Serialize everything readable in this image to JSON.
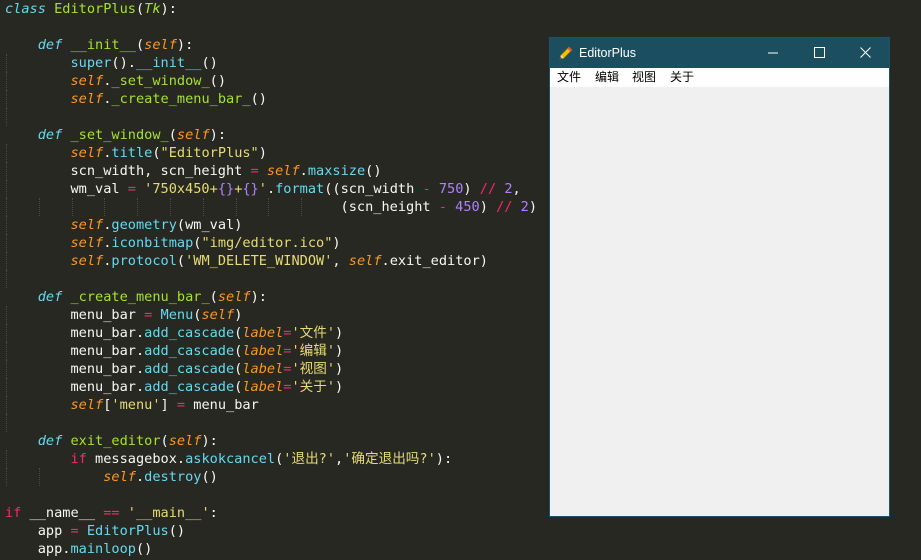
{
  "code": {
    "lines": [
      [
        [
          "kwi",
          "class"
        ],
        [
          "plain",
          " "
        ],
        [
          "cls",
          "EditorPlus"
        ],
        [
          "plain",
          "("
        ],
        [
          "inh",
          "Tk"
        ],
        [
          "plain",
          "):"
        ]
      ],
      [],
      [
        [
          "plain",
          "    "
        ],
        [
          "kwi",
          "def"
        ],
        [
          "plain",
          " "
        ],
        [
          "fn",
          "__init__"
        ],
        [
          "plain",
          "("
        ],
        [
          "self",
          "self"
        ],
        [
          "plain",
          "):"
        ]
      ],
      [
        [
          "plain",
          "        "
        ],
        [
          "builtin",
          "super"
        ],
        [
          "plain",
          "()."
        ],
        [
          "builtin",
          "__init__"
        ],
        [
          "plain",
          "()"
        ]
      ],
      [
        [
          "plain",
          "        "
        ],
        [
          "self",
          "self"
        ],
        [
          "plain",
          "."
        ],
        [
          "fn",
          "_set_window_"
        ],
        [
          "plain",
          "()"
        ]
      ],
      [
        [
          "plain",
          "        "
        ],
        [
          "self",
          "self"
        ],
        [
          "plain",
          "."
        ],
        [
          "fn",
          "_create_menu_bar_"
        ],
        [
          "plain",
          "()"
        ]
      ],
      [],
      [
        [
          "plain",
          "    "
        ],
        [
          "kwi",
          "def"
        ],
        [
          "plain",
          " "
        ],
        [
          "fn",
          "_set_window_"
        ],
        [
          "plain",
          "("
        ],
        [
          "self",
          "self"
        ],
        [
          "plain",
          "):"
        ]
      ],
      [
        [
          "plain",
          "        "
        ],
        [
          "self",
          "self"
        ],
        [
          "plain",
          "."
        ],
        [
          "builtin",
          "title"
        ],
        [
          "plain",
          "("
        ],
        [
          "str",
          "\"EditorPlus\""
        ],
        [
          "plain",
          ")"
        ]
      ],
      [
        [
          "plain",
          "        scn_width, scn_height "
        ],
        [
          "op",
          "="
        ],
        [
          "plain",
          " "
        ],
        [
          "self",
          "self"
        ],
        [
          "plain",
          "."
        ],
        [
          "builtin",
          "maxsize"
        ],
        [
          "plain",
          "()"
        ]
      ],
      [
        [
          "plain",
          "        wm_val "
        ],
        [
          "op",
          "="
        ],
        [
          "plain",
          " "
        ],
        [
          "str",
          "'750x450+"
        ],
        [
          "num",
          "{}"
        ],
        [
          "str",
          "+"
        ],
        [
          "num",
          "{}"
        ],
        [
          "str",
          "'"
        ],
        [
          "plain",
          "."
        ],
        [
          "builtin",
          "format"
        ],
        [
          "plain",
          "((scn_width "
        ],
        [
          "op",
          "-"
        ],
        [
          "plain",
          " "
        ],
        [
          "num",
          "750"
        ],
        [
          "plain",
          ") "
        ],
        [
          "op",
          "//"
        ],
        [
          "plain",
          " "
        ],
        [
          "num",
          "2"
        ],
        [
          "plain",
          ","
        ]
      ],
      [
        [
          "plain",
          "                                         (scn_height "
        ],
        [
          "op",
          "-"
        ],
        [
          "plain",
          " "
        ],
        [
          "num",
          "450"
        ],
        [
          "plain",
          ") "
        ],
        [
          "op",
          "//"
        ],
        [
          "plain",
          " "
        ],
        [
          "num",
          "2"
        ],
        [
          "plain",
          ")"
        ]
      ],
      [
        [
          "plain",
          "        "
        ],
        [
          "self",
          "self"
        ],
        [
          "plain",
          "."
        ],
        [
          "builtin",
          "geometry"
        ],
        [
          "plain",
          "(wm_val)"
        ]
      ],
      [
        [
          "plain",
          "        "
        ],
        [
          "self",
          "self"
        ],
        [
          "plain",
          "."
        ],
        [
          "builtin",
          "iconbitmap"
        ],
        [
          "plain",
          "("
        ],
        [
          "str",
          "\"img/editor.ico\""
        ],
        [
          "plain",
          ")"
        ]
      ],
      [
        [
          "plain",
          "        "
        ],
        [
          "self",
          "self"
        ],
        [
          "plain",
          "."
        ],
        [
          "builtin",
          "protocol"
        ],
        [
          "plain",
          "("
        ],
        [
          "str",
          "'WM_DELETE_WINDOW'"
        ],
        [
          "plain",
          ", "
        ],
        [
          "self",
          "self"
        ],
        [
          "plain",
          ".exit_editor)"
        ]
      ],
      [],
      [
        [
          "plain",
          "    "
        ],
        [
          "kwi",
          "def"
        ],
        [
          "plain",
          " "
        ],
        [
          "fn",
          "_create_menu_bar_"
        ],
        [
          "plain",
          "("
        ],
        [
          "self",
          "self"
        ],
        [
          "plain",
          "):"
        ]
      ],
      [
        [
          "plain",
          "        menu_bar "
        ],
        [
          "op",
          "="
        ],
        [
          "plain",
          " "
        ],
        [
          "builtin",
          "Menu"
        ],
        [
          "plain",
          "("
        ],
        [
          "self",
          "self"
        ],
        [
          "plain",
          ")"
        ]
      ],
      [
        [
          "plain",
          "        menu_bar."
        ],
        [
          "builtin",
          "add_cascade"
        ],
        [
          "plain",
          "("
        ],
        [
          "param",
          "label"
        ],
        [
          "op",
          "="
        ],
        [
          "str",
          "'文件'"
        ],
        [
          "plain",
          ")"
        ]
      ],
      [
        [
          "plain",
          "        menu_bar."
        ],
        [
          "builtin",
          "add_cascade"
        ],
        [
          "plain",
          "("
        ],
        [
          "param",
          "label"
        ],
        [
          "op",
          "="
        ],
        [
          "str",
          "'编辑'"
        ],
        [
          "plain",
          ")"
        ]
      ],
      [
        [
          "plain",
          "        menu_bar."
        ],
        [
          "builtin",
          "add_cascade"
        ],
        [
          "plain",
          "("
        ],
        [
          "param",
          "label"
        ],
        [
          "op",
          "="
        ],
        [
          "str",
          "'视图'"
        ],
        [
          "plain",
          ")"
        ]
      ],
      [
        [
          "plain",
          "        menu_bar."
        ],
        [
          "builtin",
          "add_cascade"
        ],
        [
          "plain",
          "("
        ],
        [
          "param",
          "label"
        ],
        [
          "op",
          "="
        ],
        [
          "str",
          "'关于'"
        ],
        [
          "plain",
          ")"
        ]
      ],
      [
        [
          "plain",
          "        "
        ],
        [
          "self",
          "self"
        ],
        [
          "plain",
          "["
        ],
        [
          "str",
          "'menu'"
        ],
        [
          "plain",
          "] "
        ],
        [
          "op",
          "="
        ],
        [
          "plain",
          " menu_bar"
        ]
      ],
      [],
      [
        [
          "plain",
          "    "
        ],
        [
          "kwi",
          "def"
        ],
        [
          "plain",
          " "
        ],
        [
          "fn",
          "exit_editor"
        ],
        [
          "plain",
          "("
        ],
        [
          "self",
          "self"
        ],
        [
          "plain",
          "):"
        ]
      ],
      [
        [
          "plain",
          "        "
        ],
        [
          "kw",
          "if"
        ],
        [
          "plain",
          " messagebox."
        ],
        [
          "builtin",
          "askokcancel"
        ],
        [
          "plain",
          "("
        ],
        [
          "str",
          "'退出?'"
        ],
        [
          "plain",
          ","
        ],
        [
          "str",
          "'确定退出吗?'"
        ],
        [
          "plain",
          "):"
        ]
      ],
      [
        [
          "plain",
          "            "
        ],
        [
          "self",
          "self"
        ],
        [
          "plain",
          "."
        ],
        [
          "builtin",
          "destroy"
        ],
        [
          "plain",
          "()"
        ]
      ],
      [],
      [
        [
          "kw",
          "if"
        ],
        [
          "plain",
          " __name__ "
        ],
        [
          "op",
          "=="
        ],
        [
          "plain",
          " "
        ],
        [
          "str",
          "'__main__'"
        ],
        [
          "plain",
          ":"
        ]
      ],
      [
        [
          "plain",
          "    app "
        ],
        [
          "op",
          "="
        ],
        [
          "plain",
          " "
        ],
        [
          "builtin",
          "EditorPlus"
        ],
        [
          "plain",
          "()"
        ]
      ],
      [
        [
          "plain",
          "    app."
        ],
        [
          "builtin",
          "mainloop"
        ],
        [
          "plain",
          "()"
        ]
      ]
    ]
  },
  "window": {
    "title": "EditorPlus",
    "icon": "pencil-icon",
    "controls": [
      "minimize-icon",
      "maximize-icon",
      "close-icon"
    ],
    "menu": [
      "文件",
      "编辑",
      "视图",
      "关于"
    ],
    "titlebar_color": "#1b4f5f",
    "client_color": "#f0f0f0"
  },
  "theme": {
    "background": "#272822",
    "keyword": "#f92672",
    "builtin": "#66d9ef",
    "function": "#a6e22e",
    "self": "#fd971f",
    "string": "#e6db74",
    "number": "#ae81ff",
    "text": "#f8f8f2"
  }
}
